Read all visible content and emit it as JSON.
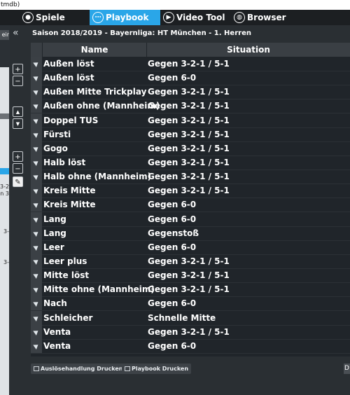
{
  "window": {
    "title_fragment": "tmdb)"
  },
  "nav": {
    "tabs": [
      {
        "label": "Spiele",
        "icon": "soccer-ball-icon",
        "active": false
      },
      {
        "label": "Playbook",
        "icon": "playbook-icon",
        "active": true
      },
      {
        "label": "Video Tool",
        "icon": "play-icon",
        "active": false
      },
      {
        "label": "Browser",
        "icon": "globe-icon",
        "active": false
      }
    ],
    "active_color": "#2aa6e8"
  },
  "left_strip": {
    "tab_fragment": "eir",
    "text_fragments": [
      "3-2-",
      "n 3",
      "3-",
      "3-"
    ]
  },
  "tools": {
    "collapse": "«",
    "zoom_in": "+",
    "zoom_out": "−",
    "up": "▲",
    "down": "▼",
    "add": "+",
    "remove": "−",
    "edit": "✎"
  },
  "header": {
    "season_line": "Saison 2018/2019 - Bayernliga:  HT München - 1. Herren"
  },
  "table": {
    "columns": {
      "name": "Name",
      "situation": "Situation"
    },
    "rows": [
      {
        "name": "Außen löst",
        "situation": "Gegen 3-2-1 / 5-1"
      },
      {
        "name": "Außen löst",
        "situation": "Gegen 6-0"
      },
      {
        "name": "Außen Mitte Trickplay",
        "situation": "Gegen 3-2-1 / 5-1"
      },
      {
        "name": "Außen ohne (Mannheim)",
        "situation": "Gegen 3-2-1 / 5-1"
      },
      {
        "name": "Doppel TUS",
        "situation": "Gegen 3-2-1 / 5-1"
      },
      {
        "name": "Fürsti",
        "situation": "Gegen 3-2-1 / 5-1"
      },
      {
        "name": "Gogo",
        "situation": "Gegen 3-2-1 / 5-1"
      },
      {
        "name": "Halb löst",
        "situation": "Gegen 3-2-1 / 5-1"
      },
      {
        "name": "Halb ohne (Mannheim)",
        "situation": "Gegen 3-2-1 / 5-1"
      },
      {
        "name": "Kreis Mitte",
        "situation": "Gegen 3-2-1 / 5-1"
      },
      {
        "name": "Kreis Mitte",
        "situation": "Gegen 6-0"
      },
      {
        "name": "Lang",
        "situation": "Gegen 6-0"
      },
      {
        "name": "Lang",
        "situation": "Gegenstoß"
      },
      {
        "name": "Leer",
        "situation": "Gegen 6-0"
      },
      {
        "name": "Leer plus",
        "situation": "Gegen 3-2-1 / 5-1"
      },
      {
        "name": "Mitte löst",
        "situation": "Gegen 3-2-1 / 5-1"
      },
      {
        "name": "Mitte ohne (Mannheim)",
        "situation": "Gegen 3-2-1 / 5-1"
      },
      {
        "name": "Nach",
        "situation": "Gegen 6-0"
      },
      {
        "name": "Schleicher",
        "situation": "Schnelle Mitte"
      },
      {
        "name": "Venta",
        "situation": "Gegen 3-2-1 / 5-1"
      },
      {
        "name": "Venta",
        "situation": "Gegen 6-0"
      }
    ]
  },
  "footer": {
    "print_trigger_label": "Auslösehandlung Drucken",
    "print_playbook_label": "Playbook Drucken",
    "right_fragment": "D"
  }
}
